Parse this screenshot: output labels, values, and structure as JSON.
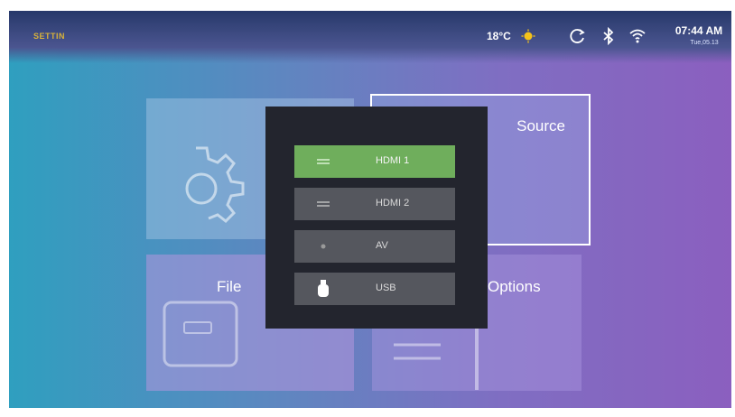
{
  "header": {
    "brand": "SETTIN",
    "temperature": "18°C",
    "weather_icon": "sun-icon",
    "status_icons": [
      "sync-icon",
      "bluetooth-icon",
      "wifi-icon"
    ],
    "time": "07:44 AM",
    "date": "Tue,05.13"
  },
  "tiles": {
    "settings": {
      "icon": "gear-icon"
    },
    "source": {
      "label": "Source"
    },
    "files": {
      "label": "File",
      "icon": "folder-icon"
    },
    "options": {
      "label": "Options",
      "icon": "lines-icon"
    }
  },
  "source_menu": {
    "selected": "HDMI 1",
    "items": [
      {
        "label": "HDMI 1",
        "icon": "hdmi-icon"
      },
      {
        "label": "HDMI 2",
        "icon": "hdmi-icon"
      },
      {
        "label": "AV",
        "icon": "av-icon"
      },
      {
        "label": "USB",
        "icon": "usb-icon"
      }
    ]
  },
  "colors": {
    "accent_selected": "#6fae5c",
    "popup_background": "#23252e",
    "menu_item": "#55575e",
    "brand_text": "#d8b23a"
  }
}
